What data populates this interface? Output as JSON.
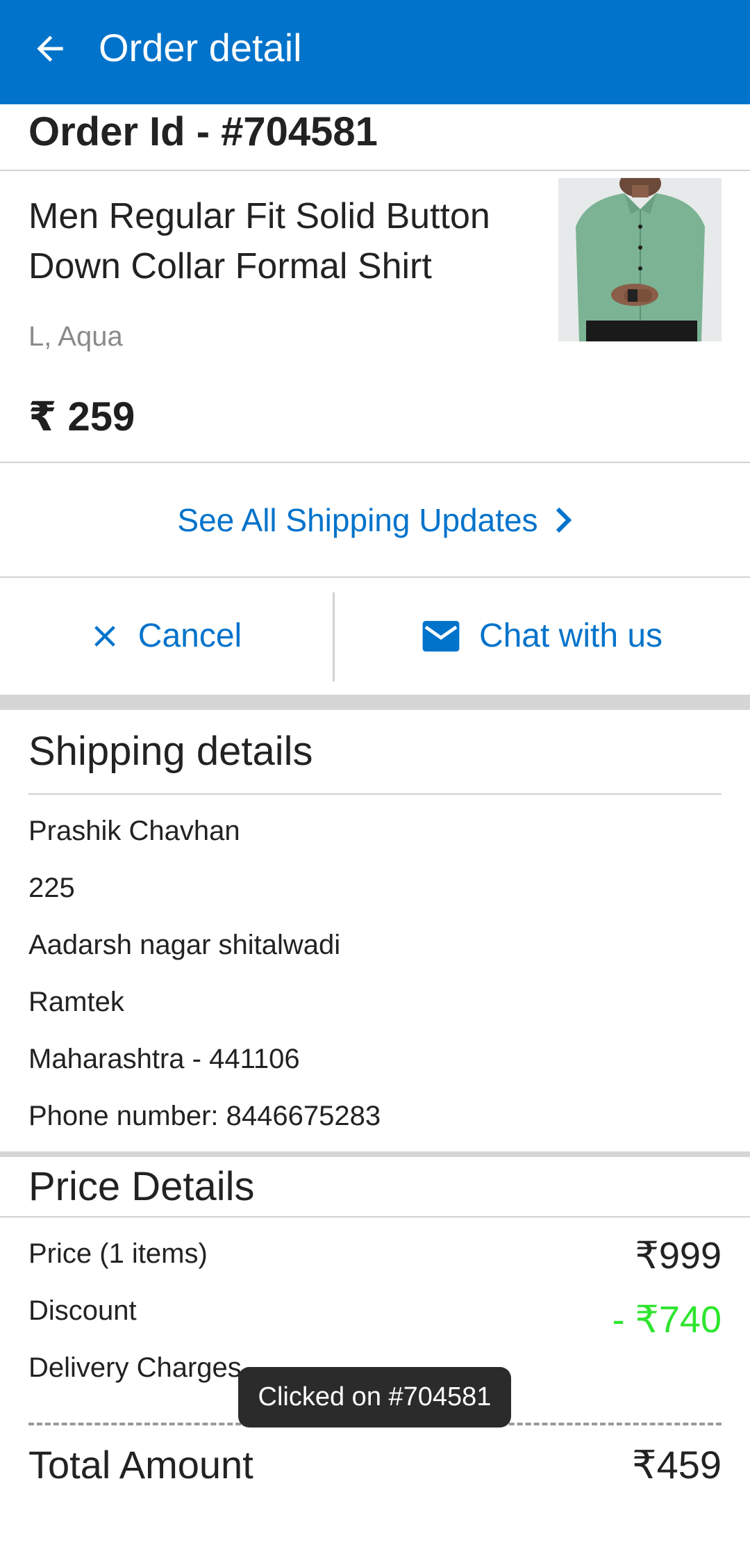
{
  "appbar": {
    "title": "Order detail",
    "back_icon": "arrow-left-icon",
    "bg_color": "#0273cb"
  },
  "order": {
    "id_label": "Order Id - #704581"
  },
  "product": {
    "name": "Men Regular Fit Solid Button Down Collar Formal Shirt",
    "variant": "L, Aqua",
    "price": "₹ 259",
    "image_icon": "shirt-product-image"
  },
  "shipping_link": {
    "label": "See All Shipping Updates",
    "icon": "chevron-right-icon"
  },
  "actions": {
    "cancel_label": "Cancel",
    "cancel_icon": "close-icon",
    "chat_label": "Chat with us",
    "chat_icon": "mail-icon"
  },
  "shipping_details": {
    "title": "Shipping details",
    "lines": [
      "Prashik Chavhan",
      "225",
      "Aadarsh nagar shitalwadi",
      "Ramtek",
      "Maharashtra - 441106",
      "Phone number: 8446675283"
    ]
  },
  "price_details": {
    "title": "Price Details",
    "rows": [
      {
        "label": "Price (1 items)",
        "value": "₹999"
      },
      {
        "label": "Discount",
        "value": "- ₹740"
      },
      {
        "label": "Delivery Charges",
        "value": ""
      }
    ],
    "total_label": "Total Amount",
    "total_value": "₹459",
    "discount_color": "#2ee52e"
  },
  "toast": {
    "text": "Clicked on #704581"
  }
}
